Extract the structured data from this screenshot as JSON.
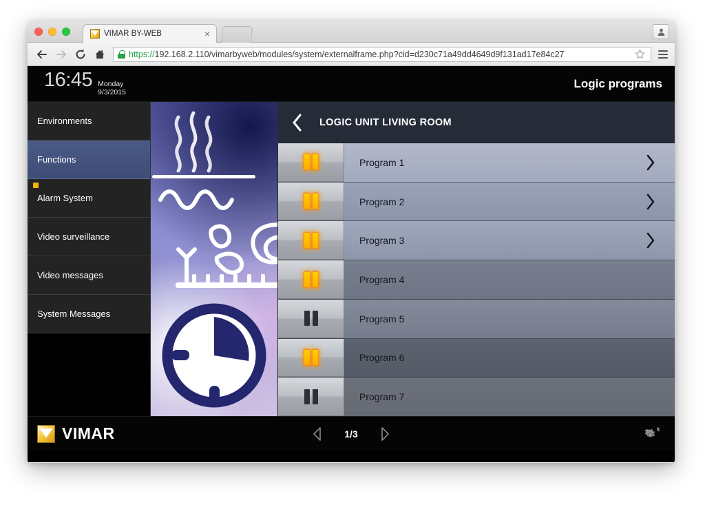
{
  "browser": {
    "tab": {
      "title": "VIMAR BY-WEB",
      "favicon": "vimar-favicon",
      "close_label": "×"
    },
    "traffic_lights": [
      "close-red",
      "minimize-yellow",
      "zoom-green"
    ],
    "nav": {
      "back_label": "back-arrow-icon",
      "forward_label": "forward-arrow-icon",
      "reload_label": "reload-icon",
      "home_label": "home-icon"
    },
    "url": {
      "scheme": "https://",
      "rest": "192.168.2.110/vimarbyweb/modules/system/externalframe.php?cid=d230c71a49dd4649d9f131ad17e84c27",
      "full": "https://192.168.2.110/vimarbyweb/modules/system/externalframe.php?cid=d230c71a49dd4649d9f131ad17e84c27",
      "secure": true,
      "lock_icon": "lock-icon",
      "bookmark_icon": "star-icon"
    },
    "menu_icon": "hamburger-menu-icon",
    "profile_icon": "user-avatar-icon"
  },
  "header": {
    "time": "16:45",
    "day": "Monday",
    "date": "9/3/2015",
    "title": "Logic programs"
  },
  "sidebar": {
    "items": [
      {
        "label": "Environments",
        "selected": false,
        "badge": null
      },
      {
        "label": "Functions",
        "selected": true,
        "badge": null
      },
      {
        "label": "Alarm System",
        "selected": false,
        "badge": "#f2b705"
      },
      {
        "label": "Video surveillance",
        "selected": false,
        "badge": null
      },
      {
        "label": "Video messages",
        "selected": false,
        "badge": null
      },
      {
        "label": "System Messages",
        "selected": false,
        "badge": null
      }
    ]
  },
  "illustration": {
    "name": "home-automation-illustration",
    "motifs": [
      "steam-waves",
      "water-ripples",
      "plant-leaves",
      "comb-rake",
      "timer-dial"
    ]
  },
  "content": {
    "back_icon": "back-chevron-icon",
    "unit_title": "LOGIC UNIT LIVING ROOM",
    "programs": [
      {
        "label": "Program 1",
        "state": "on",
        "chevron": true,
        "icon": "pause-icon"
      },
      {
        "label": "Program 2",
        "state": "on",
        "chevron": true,
        "icon": "pause-icon"
      },
      {
        "label": "Program 3",
        "state": "on",
        "chevron": true,
        "icon": "pause-icon"
      },
      {
        "label": "Program 4",
        "state": "on",
        "chevron": false,
        "icon": "pause-icon"
      },
      {
        "label": "Program 5",
        "state": "off",
        "chevron": false,
        "icon": "pause-icon"
      },
      {
        "label": "Program 6",
        "state": "on",
        "chevron": false,
        "icon": "pause-icon"
      },
      {
        "label": "Program 7",
        "state": "off",
        "chevron": false,
        "icon": "pause-icon"
      }
    ]
  },
  "footer": {
    "brand": "VIMAR",
    "logo_icon": "vimar-logo-icon",
    "prev_icon": "prev-page-triangle-icon",
    "next_icon": "next-page-triangle-icon",
    "page_indicator": "1/3",
    "settings_icon": "gears-settings-icon"
  },
  "colors": {
    "accent_selected": "#4b5a87",
    "badge_alarm": "#f2b705",
    "pause_on": "#ffc000",
    "pause_off": "#2d3038",
    "brand_gold": "#f7cc47",
    "app_black": "#050505"
  }
}
